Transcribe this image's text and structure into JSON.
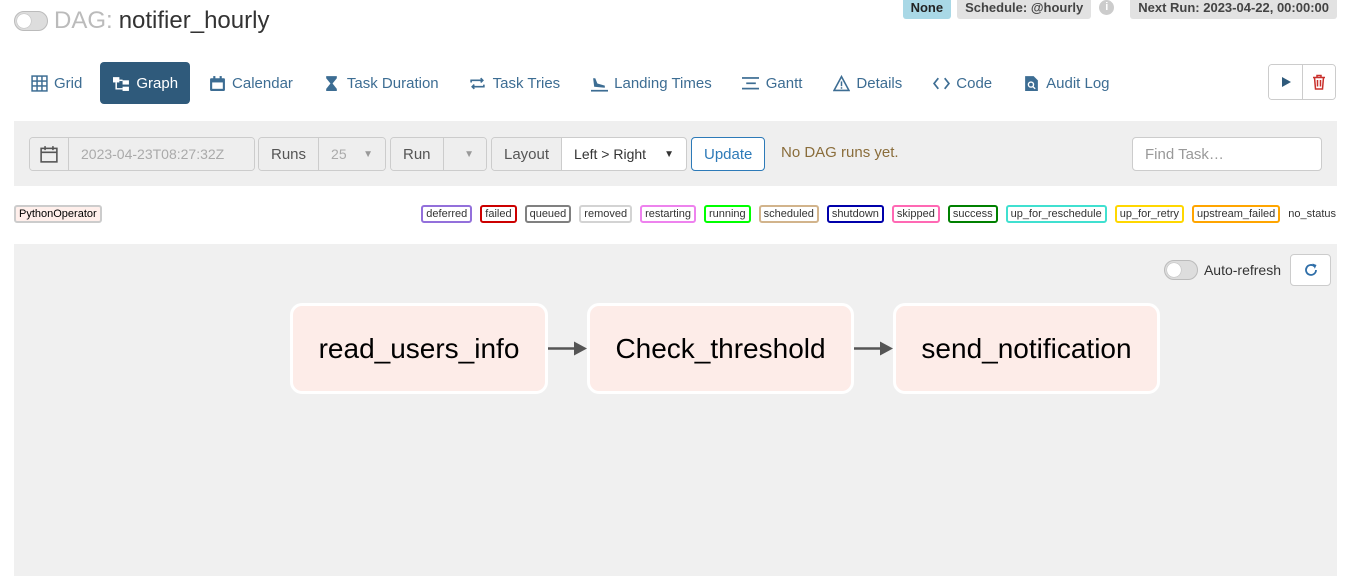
{
  "header": {
    "dag_prefix": "DAG:",
    "dag_id": "notifier_hourly",
    "badge_state": "None",
    "schedule": "Schedule: @hourly",
    "info_glyph": "i",
    "next_run": "Next Run: 2023-04-22, 00:00:00"
  },
  "tabs": [
    {
      "label": "Grid",
      "icon": "grid-icon"
    },
    {
      "label": "Graph",
      "icon": "graph-icon",
      "active": true
    },
    {
      "label": "Calendar",
      "icon": "calendar-icon"
    },
    {
      "label": "Task Duration",
      "icon": "hourglass-icon"
    },
    {
      "label": "Task Tries",
      "icon": "retry-icon"
    },
    {
      "label": "Landing Times",
      "icon": "landing-icon"
    },
    {
      "label": "Gantt",
      "icon": "gantt-icon"
    },
    {
      "label": "Details",
      "icon": "warning-triangle-icon"
    },
    {
      "label": "Code",
      "icon": "code-icon"
    },
    {
      "label": "Audit Log",
      "icon": "audit-log-icon"
    }
  ],
  "actions": {
    "trigger_icon": "play-icon",
    "delete_icon": "trash-icon"
  },
  "toolbar": {
    "base_date": "2023-04-23T08:27:32Z",
    "runs_label": "Runs",
    "runs_value": "25",
    "run_label": "Run",
    "run_value": "",
    "layout_label": "Layout",
    "layout_value": "Left > Right",
    "update_label": "Update",
    "no_runs_text": "No DAG runs yet.",
    "find_task_placeholder": "Find Task…"
  },
  "operator_badge": "PythonOperator",
  "states": [
    "deferred",
    "failed",
    "queued",
    "removed",
    "restarting",
    "running",
    "scheduled",
    "shutdown",
    "skipped",
    "success",
    "up_for_reschedule",
    "up_for_retry",
    "upstream_failed",
    "no_status"
  ],
  "state_colors": {
    "deferred": "#9370db",
    "failed": "#cc0000",
    "queued": "#808080",
    "removed": "#d3d3d3",
    "restarting": "#ee82ee",
    "running": "#00ff00",
    "scheduled": "#d2b48c",
    "shutdown": "#0000aa",
    "skipped": "#ff69b4",
    "success": "#008000",
    "up_for_reschedule": "#40e0d0",
    "up_for_retry": "#ffd700",
    "upstream_failed": "#ffa500",
    "no_status": ""
  },
  "graph": {
    "auto_refresh_label": "Auto-refresh",
    "nodes": [
      "read_users_info",
      "Check_threshold",
      "send_notification"
    ]
  }
}
